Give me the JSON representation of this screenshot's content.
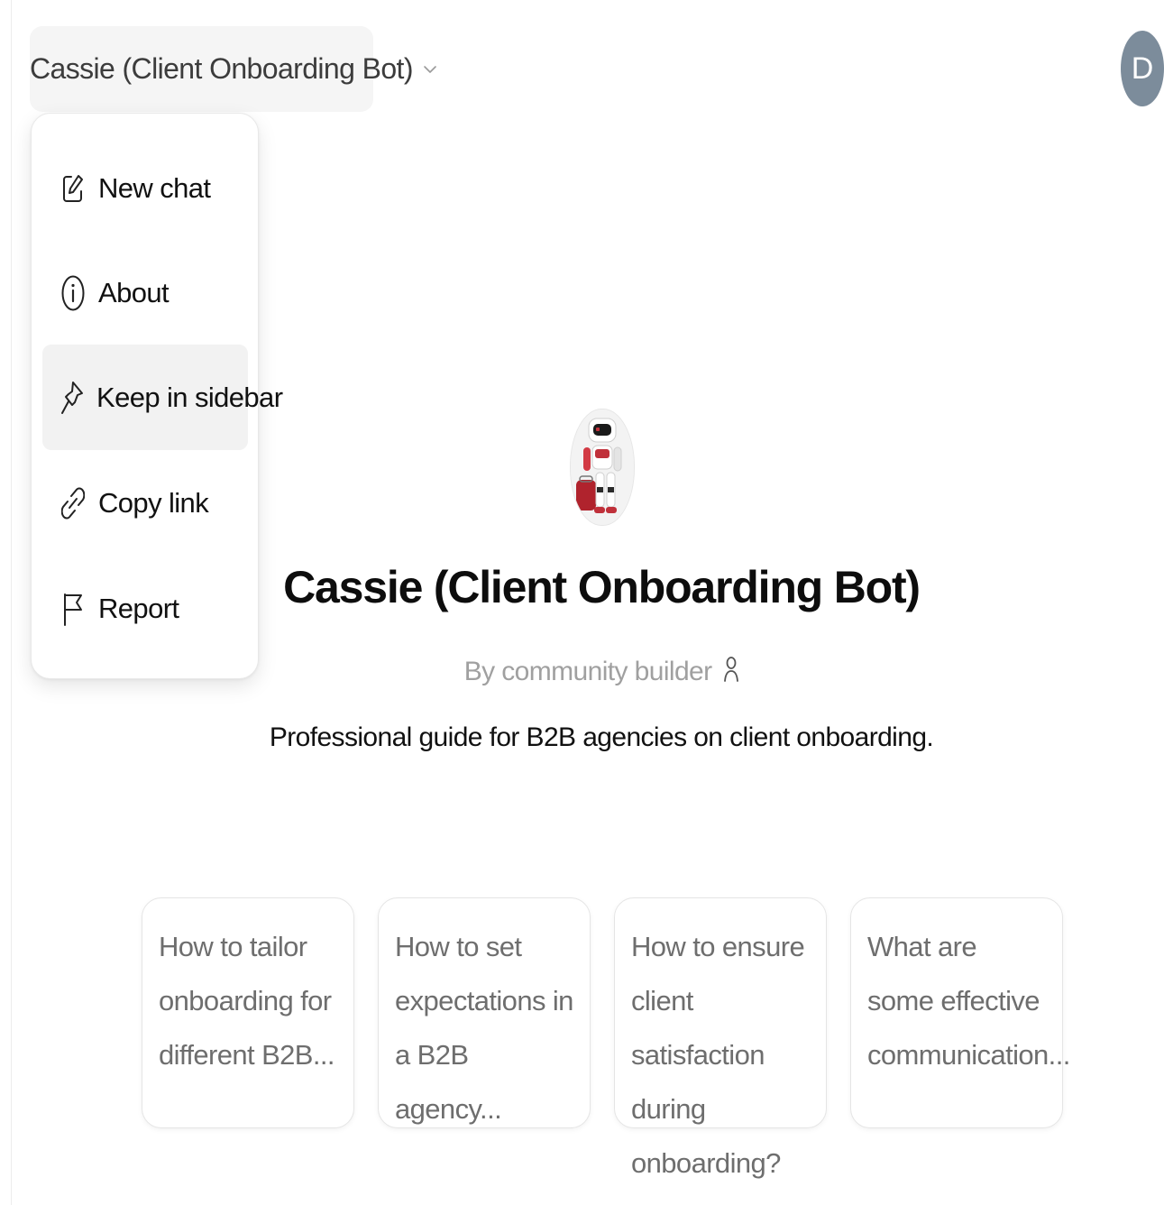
{
  "header": {
    "model_title": "Cassie (Client Onboarding Bot)",
    "chevron_icon": "chevron-down-icon",
    "user_avatar_letter": "D",
    "avatar_color": "#7c8c9b"
  },
  "menu": {
    "items": [
      {
        "label": "New chat",
        "icon": "edit-pencil-icon"
      },
      {
        "label": "About",
        "icon": "info-icon"
      },
      {
        "label": "Keep in sidebar",
        "icon": "pin-icon",
        "highlighted": true
      },
      {
        "label": "Copy link",
        "icon": "link-icon"
      },
      {
        "label": "Report",
        "icon": "flag-icon"
      }
    ]
  },
  "profile": {
    "avatar_icon": "robot-avatar",
    "name": "Cassie (Client Onboarding Bot)",
    "author": "By community builder",
    "author_icon": "person-icon",
    "description": "Professional guide for B2B agencies on client onboarding."
  },
  "prompts": [
    {
      "text": "How to tailor\nonboarding for\ndifferent B2B..."
    },
    {
      "text": "How to set\nexpectations in\na B2B agency..."
    },
    {
      "text": "How to ensure\nclient satisfaction\nduring onboarding?"
    },
    {
      "text": "What are\nsome effective\ncommunication..."
    }
  ]
}
